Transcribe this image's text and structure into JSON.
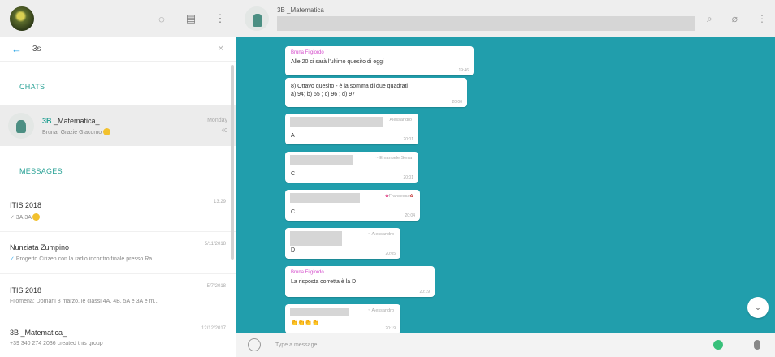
{
  "left": {
    "header_icons": [
      "status-icon",
      "new-chat-icon",
      "menu-icon"
    ],
    "search": {
      "back_icon": "arrow-left-icon",
      "query": "3s",
      "clear_icon": "close-icon"
    },
    "section_chats": "CHATS",
    "chat_hit": {
      "title_prefix": "3B",
      "title_rest": " _Matematica_",
      "subtitle": "Bruna: Grazie Giacomo",
      "day": "Monday",
      "badge": "40"
    },
    "section_messages": "MESSAGES",
    "messages": [
      {
        "title": "ITIS 2018",
        "time": "13:29",
        "subtitle": "✓ 3A,3A ",
        "tick": true
      },
      {
        "title": "Nunziata Zumpino",
        "time": "5/11/2018",
        "subtitle": "Progetto Citizen con la radio incontro finale presso Ra...",
        "tick": true
      },
      {
        "title": "ITIS 2018",
        "time": "5/7/2018",
        "subtitle": "Filomena: Domani 8 marzo, le classi 4A, 4B, 5A e 3A e m...",
        "tick": false
      },
      {
        "title": "3B _Matematica_",
        "time": "12/12/2017",
        "subtitle": "+39 340 274 2036 created this group",
        "tick": false
      }
    ]
  },
  "right": {
    "title": "3B _Matematica",
    "header_icons": [
      "search-icon",
      "attach-icon",
      "menu-icon"
    ],
    "bubbles": [
      {
        "sender": "Bruna Filgiordo",
        "text": "Alle 20 ci sarà l'ultimo quesito di oggi",
        "time": "19:46"
      },
      {
        "sender": "",
        "text": "8) Ottavo quesito - è la somma di due quadrati",
        "text2": "a) 94; b) 55 ; c) 96 ; d) 97",
        "time": "20:00"
      },
      {
        "name": "Alessandro",
        "text": "A",
        "time": "20:01"
      },
      {
        "name": "~ Emanuele Serra",
        "text": "C",
        "time": "20:01"
      },
      {
        "name": "Francesca",
        "text": "C",
        "time": "20:04"
      },
      {
        "name": "~ Alessandro",
        "text": "D",
        "time": "20:05"
      },
      {
        "sender": "Bruna Filgiordo",
        "text": "La risposta corretta è la D",
        "time": "20:19"
      },
      {
        "name": "~ Alessandro",
        "text": "👏👏👏👏",
        "time": "20:19"
      }
    ],
    "composer": {
      "placeholder": "Type a message"
    }
  },
  "colors": {
    "chat_bg": "#219eac",
    "accent": "#2aa296",
    "sender": "#d44acb"
  }
}
